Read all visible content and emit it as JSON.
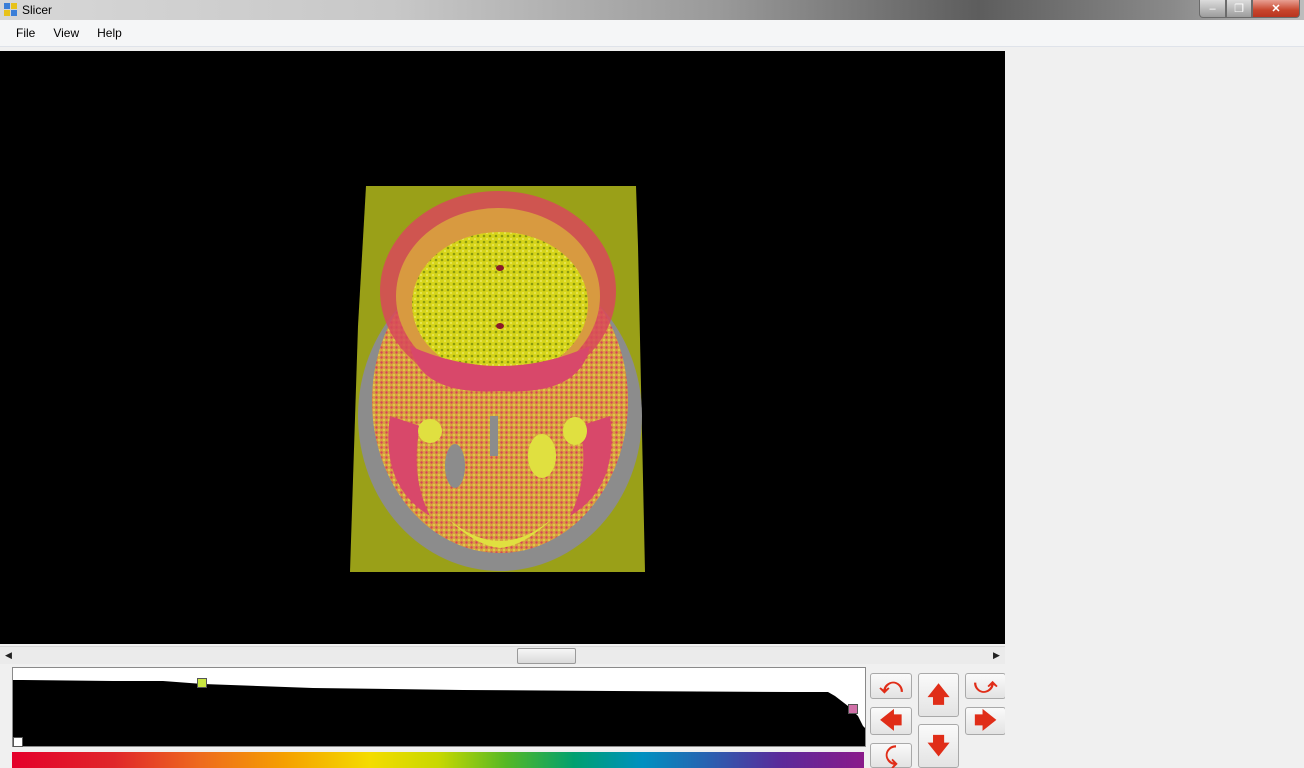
{
  "window": {
    "title": "Slicer",
    "controls": {
      "minimize": "–",
      "maximize": "❐",
      "close": "✕"
    }
  },
  "menu": {
    "items": [
      "File",
      "View",
      "Help"
    ]
  },
  "scrollbar": {
    "left_arrow": "◀",
    "right_arrow": "▶",
    "position": 0.52
  },
  "histogram": {
    "handles": [
      {
        "name": "low",
        "color": "#ffffff"
      },
      {
        "name": "mid",
        "color": "#c8e640"
      },
      {
        "name": "high",
        "color": "#d070a8"
      },
      {
        "name": "top-left",
        "color": "#ffffff"
      }
    ]
  },
  "navigation": {
    "rotate_ccw": "⤺",
    "up": "🡅",
    "rotate_cw": "⤻",
    "left": "🡄",
    "right": "🡆",
    "flip": "⤹",
    "down": "🡇"
  },
  "colors": {
    "accent": "#e02d18",
    "viewport_bg": "#000000"
  }
}
